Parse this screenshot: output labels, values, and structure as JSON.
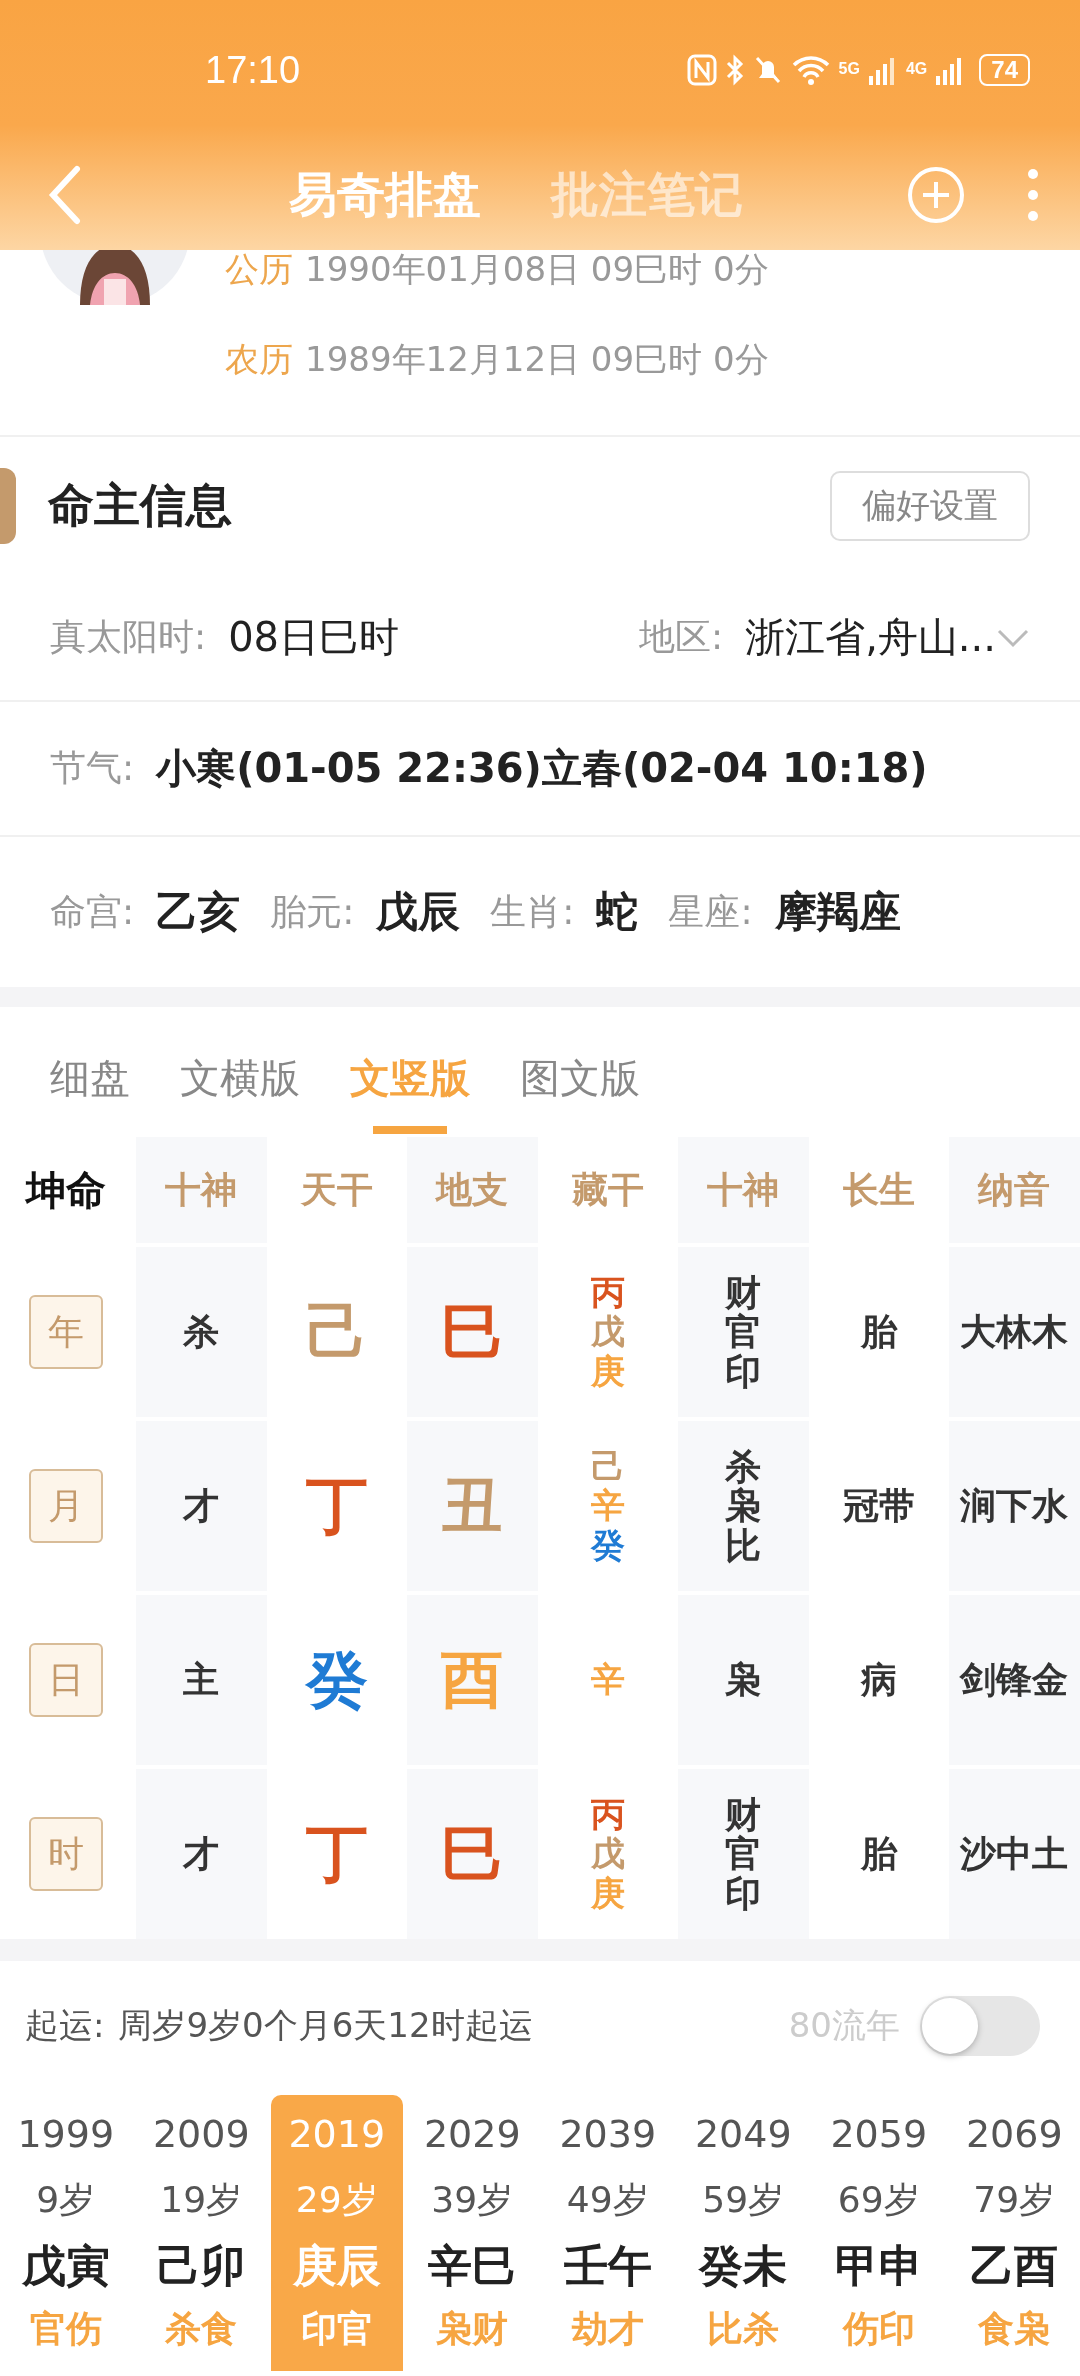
{
  "status_bar": {
    "time": "17:10",
    "network_5g": "5G",
    "network_4g": "4G",
    "battery": "74"
  },
  "nav": {
    "tabs": [
      {
        "label": "易奇排盘",
        "selected": true
      },
      {
        "label": "批注笔记",
        "selected": false
      }
    ]
  },
  "profile": {
    "dates": [
      {
        "label": "公历",
        "value": "1990年01月08日 09巳时 0分"
      },
      {
        "label": "农历",
        "value": "1989年12月12日 09巳时 0分"
      }
    ]
  },
  "info": {
    "title": "命主信息",
    "settings_button": "偏好设置",
    "solar_time": {
      "label": "真太阳时:",
      "value": "08日巳时"
    },
    "region": {
      "label": "地区:",
      "value": "浙江省,舟山..."
    },
    "solar_terms": {
      "label": "节气:",
      "value": "小寒(01-05 22:36)立春(02-04 10:18)"
    },
    "attributes": [
      {
        "label": "命宫:",
        "value": "乙亥"
      },
      {
        "label": "胎元:",
        "value": "戊辰"
      },
      {
        "label": "生肖:",
        "value": "蛇"
      },
      {
        "label": "星座:",
        "value": "摩羯座"
      }
    ]
  },
  "view_tabs": [
    {
      "label": "细盘",
      "selected": false
    },
    {
      "label": "文横版",
      "selected": false
    },
    {
      "label": "文竖版",
      "selected": true
    },
    {
      "label": "图文版",
      "selected": false
    }
  ],
  "chart": {
    "corner": "坤命",
    "columns": [
      "十神",
      "天干",
      "地支",
      "藏干",
      "十神",
      "长生",
      "纳音"
    ],
    "rows": [
      {
        "pillar": "年",
        "ten_god": "杀",
        "stem": {
          "text": "己",
          "color": "#c49a6c"
        },
        "branch": {
          "text": "巳",
          "color": "#d9531e"
        },
        "hidden": [
          {
            "text": "丙",
            "color": "#d9531e"
          },
          {
            "text": "戊",
            "color": "#c49a6c"
          },
          {
            "text": "庚",
            "color": "#f6a541"
          }
        ],
        "hidden_gods": "财官印",
        "growth": "胎",
        "nayin": "大林木"
      },
      {
        "pillar": "月",
        "ten_god": "才",
        "stem": {
          "text": "丁",
          "color": "#d9531e"
        },
        "branch": {
          "text": "丑",
          "color": "#c49a6c"
        },
        "hidden": [
          {
            "text": "己",
            "color": "#c49a6c"
          },
          {
            "text": "辛",
            "color": "#f6a541"
          },
          {
            "text": "癸",
            "color": "#1f7bd4"
          }
        ],
        "hidden_gods": "杀枭比",
        "growth": "冠带",
        "nayin": "涧下水"
      },
      {
        "pillar": "日",
        "ten_god": "主",
        "stem": {
          "text": "癸",
          "color": "#1f7bd4"
        },
        "branch": {
          "text": "酉",
          "color": "#f6a541"
        },
        "hidden": [
          {
            "text": "辛",
            "color": "#f6a541"
          }
        ],
        "hidden_gods": "枭",
        "growth": "病",
        "nayin": "剑锋金"
      },
      {
        "pillar": "时",
        "ten_god": "才",
        "stem": {
          "text": "丁",
          "color": "#d9531e"
        },
        "branch": {
          "text": "巳",
          "color": "#d9531e"
        },
        "hidden": [
          {
            "text": "丙",
            "color": "#d9531e"
          },
          {
            "text": "戊",
            "color": "#c49a6c"
          },
          {
            "text": "庚",
            "color": "#f6a541"
          }
        ],
        "hidden_gods": "财官印",
        "growth": "胎",
        "nayin": "沙中土"
      }
    ]
  },
  "luck": {
    "start_label": "起运:",
    "start_value": "周岁9岁0个月6天12时起运",
    "toggle_label": "80流年",
    "toggle_on": false,
    "periods": [
      {
        "year": "1999",
        "age": "9岁",
        "ganzhi": "戊寅",
        "gods": "官伤",
        "selected": false
      },
      {
        "year": "2009",
        "age": "19岁",
        "ganzhi": "己卯",
        "gods": "杀食",
        "selected": false
      },
      {
        "year": "2019",
        "age": "29岁",
        "ganzhi": "庚辰",
        "gods": "印官",
        "selected": true
      },
      {
        "year": "2029",
        "age": "39岁",
        "ganzhi": "辛巳",
        "gods": "枭财",
        "selected": false
      },
      {
        "year": "2039",
        "age": "49岁",
        "ganzhi": "壬午",
        "gods": "劫才",
        "selected": false
      },
      {
        "year": "2049",
        "age": "59岁",
        "ganzhi": "癸未",
        "gods": "比杀",
        "selected": false
      },
      {
        "year": "2059",
        "age": "69岁",
        "ganzhi": "甲申",
        "gods": "伤印",
        "selected": false
      },
      {
        "year": "2069",
        "age": "79岁",
        "ganzhi": "乙酉",
        "gods": "食枭",
        "selected": false
      }
    ]
  }
}
